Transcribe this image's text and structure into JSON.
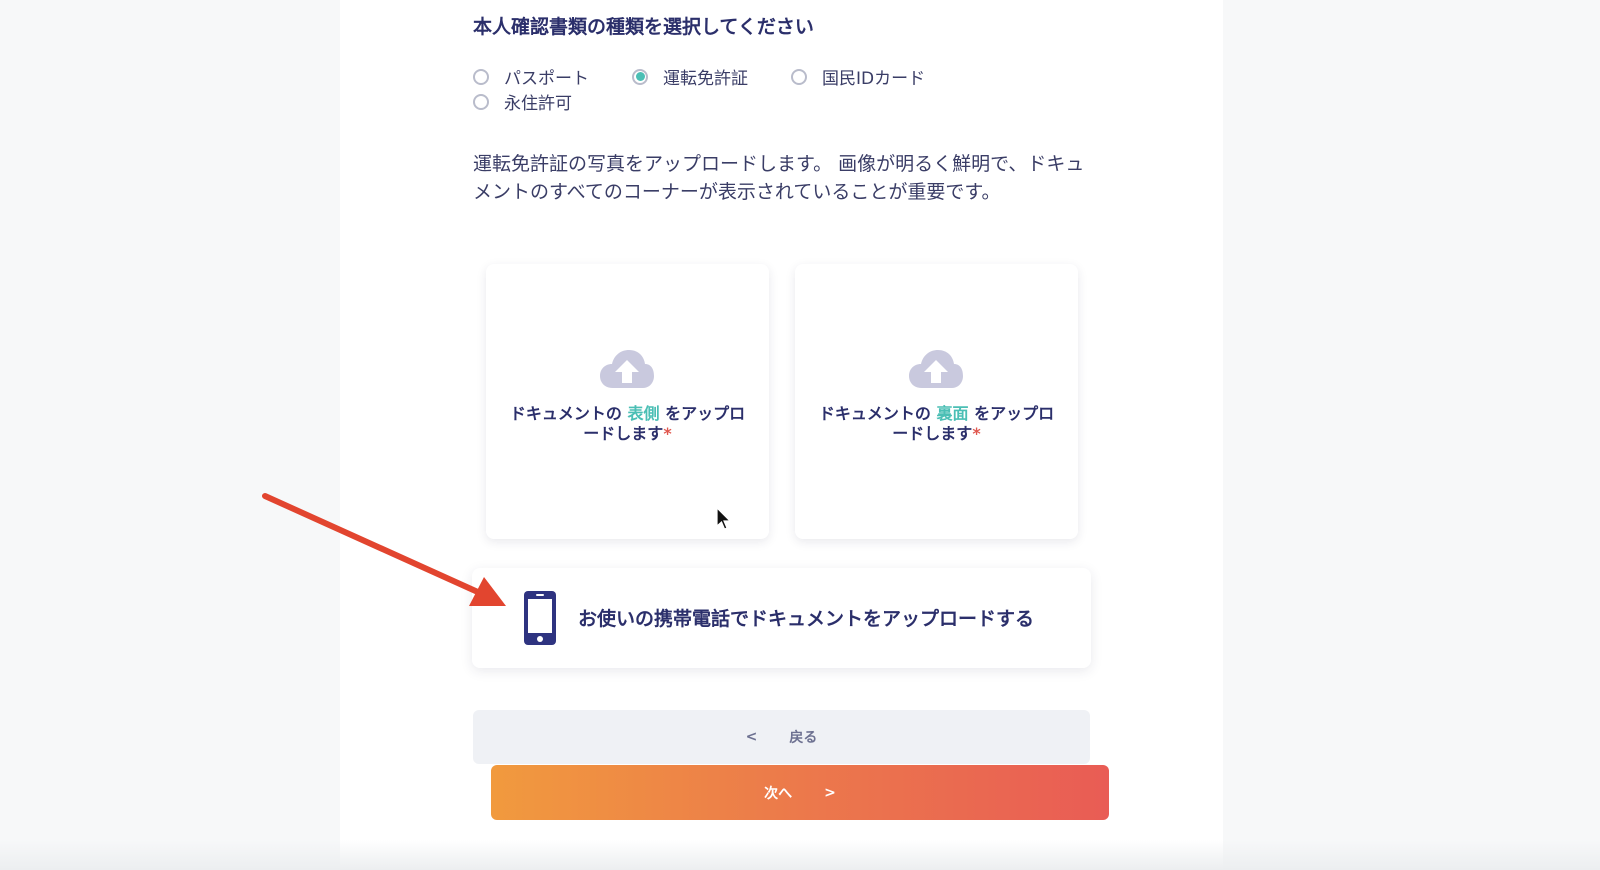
{
  "document_type": {
    "heading": "本人確認書類の種類を選択してください",
    "options": [
      {
        "label": "パスポート",
        "selected": false
      },
      {
        "label": "運転免許証",
        "selected": true
      },
      {
        "label": "国民IDカード",
        "selected": false
      },
      {
        "label": "永住許可",
        "selected": false
      }
    ]
  },
  "instruction": "運転免許証の写真をアップロードします。 画像が明るく鮮明で、ドキュメントのすべてのコーナーが表示されていることが重要です。",
  "upload_front": {
    "prefix": "ドキュメントの",
    "highlight": "表側",
    "suffix": "をアップロードします",
    "required_mark": "*",
    "icon": "cloud-upload-icon"
  },
  "upload_back": {
    "prefix": "ドキュメントの",
    "highlight": "裏面",
    "suffix": "をアップロードします",
    "required_mark": "*",
    "icon": "cloud-upload-icon"
  },
  "mobile_upload": {
    "label": "お使いの携帯電話でドキュメントをアップロードする",
    "icon": "smartphone-icon"
  },
  "navigation": {
    "back_chevron": "<",
    "back_label": "戻る",
    "next_label": "次へ",
    "next_chevron": ">"
  },
  "colors": {
    "heading": "#2b2f6b",
    "accent": "#4bbfb5",
    "required": "#e0584f",
    "next_gradient_start": "#f19a3e",
    "next_gradient_end": "#e95c55",
    "annotation_arrow": "#e2452f"
  }
}
